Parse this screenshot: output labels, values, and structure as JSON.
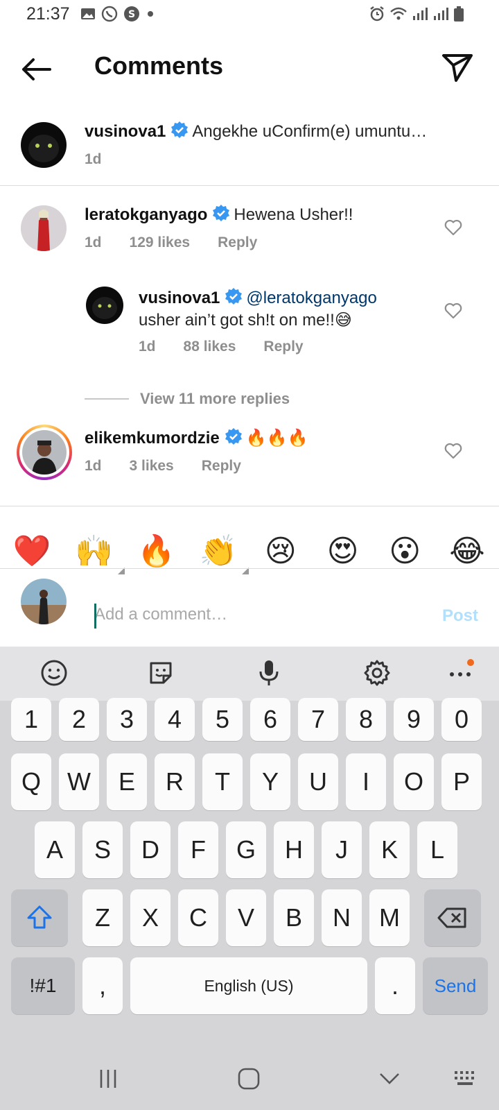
{
  "status_bar": {
    "time": "21:37"
  },
  "header": {
    "title": "Comments"
  },
  "caption": {
    "username": "vusinova1",
    "text": "Angekhe uConfirm(e) umuntu…",
    "time": "1d"
  },
  "comments": [
    {
      "username": "leratokganyago",
      "text": "Hewena Usher!!",
      "time": "1d",
      "likes": "129 likes",
      "reply_label": "Reply"
    },
    {
      "username": "vusinova1",
      "mention": "@leratokganyago",
      "text": "usher ain’t got sh!t on me!!😅",
      "time": "1d",
      "likes": "88 likes",
      "reply_label": "Reply"
    },
    {
      "username": "elikemkumordzie",
      "text": "🔥🔥🔥",
      "time": "1d",
      "likes": "3 likes",
      "reply_label": "Reply"
    }
  ],
  "view_more_replies": "View 11 more replies",
  "emoji_bar": [
    "❤️",
    "🙌",
    "🔥",
    "👏",
    "😢",
    "😍",
    "😮",
    "😂"
  ],
  "comment_box": {
    "placeholder": "Add a comment…",
    "post_label": "Post"
  },
  "keyboard": {
    "number_row": [
      "1",
      "2",
      "3",
      "4",
      "5",
      "6",
      "7",
      "8",
      "9",
      "0"
    ],
    "row1": [
      "Q",
      "W",
      "E",
      "R",
      "T",
      "Y",
      "U",
      "I",
      "O",
      "P"
    ],
    "row2": [
      "A",
      "S",
      "D",
      "F",
      "G",
      "H",
      "J",
      "K",
      "L"
    ],
    "row3": [
      "Z",
      "X",
      "C",
      "V",
      "B",
      "N",
      "M"
    ],
    "symbols_label": "!#1",
    "comma": ",",
    "space_label": "English (US)",
    "period": ".",
    "send_label": "Send"
  },
  "colors": {
    "verified": "#3897f0",
    "mention": "#00376b",
    "send_key": "#1a73e8",
    "story_ring": "#e1306c"
  }
}
